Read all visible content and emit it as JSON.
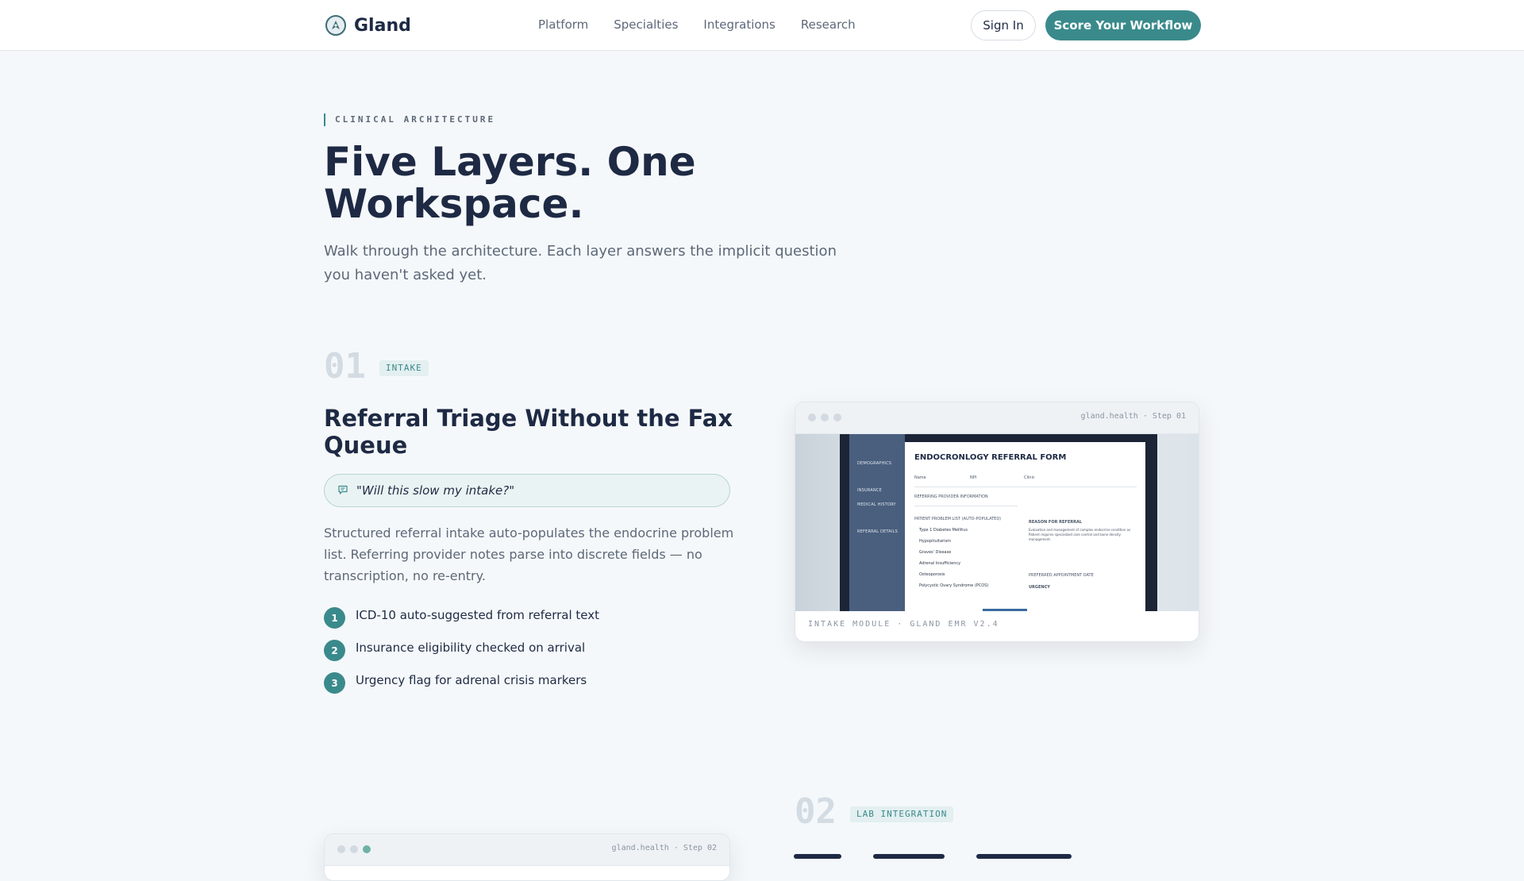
{
  "nav": {
    "brand": "Gland",
    "links": [
      "Platform",
      "Specialties",
      "Integrations",
      "Research"
    ],
    "sign_in": "Sign In",
    "cta": "Score Your Workflow"
  },
  "hero": {
    "eyebrow": "CLINICAL ARCHITECTURE",
    "title": "Five Layers. One Workspace.",
    "subtitle": "Walk through the architecture. Each layer answers the implicit question you haven't asked yet."
  },
  "step1": {
    "number": "01",
    "tag": "INTAKE",
    "title": "Referral Triage Without the Fax Queue",
    "quote": "\"Will this slow my intake?\"",
    "body": "Structured referral intake auto-populates the endocrine problem list. Referring provider notes parse into discrete fields — no transcription, no re-entry.",
    "features": [
      {
        "n": "1",
        "text": "ICD-10 auto-suggested from referral text"
      },
      {
        "n": "2",
        "text": "Insurance eligibility checked on arrival"
      },
      {
        "n": "3",
        "text": "Urgency flag for adrenal crisis markers"
      }
    ],
    "browser": {
      "url": "gland.health · Step 01",
      "caption": "INTAKE MODULE · GLAND EMR V2.4",
      "form": {
        "title": "ENDOCRONLOGY REFERRAL FORM",
        "sidebar": [
          "DEMOGRAPHICS",
          "INSURANCE",
          "MEDICAL HISTORY",
          "REFERRAL DETAILS"
        ],
        "fields": [
          "Name",
          "NPI",
          "Clinic"
        ],
        "section_provider": "REFERRING PROVIDER INFORMATION",
        "section_problems": "PATIENT PROBLEM LIST (AUTO-POPULATED)",
        "section_reason": "REASON FOR REFERRAL",
        "reason_text": "Evaluation and management of complex endocrine condition as Patient requires specialized care control and bone density management.",
        "section_date": "PREFERRED APPOINTMENT DATE",
        "section_urgency": "URGENCY",
        "problems": [
          "Type 1 Diabetes Mellitus",
          "Hypopituitarism",
          "Graves' Disease",
          "Adrenal Insufficiency",
          "Osteoporosis",
          "Polycystic Ovary Syndrome (PCOS)"
        ]
      }
    }
  },
  "step2": {
    "number": "02",
    "tag": "LAB INTEGRATION",
    "browser_url": "gland.health · Step 02"
  },
  "colors": {
    "accent": "#3a8a8c",
    "navy": "#1e2a44",
    "muted": "#5d6878",
    "background": "#f5f8fa"
  },
  "icons": {
    "logo": "gland-logo-icon",
    "quote": "speech-bubble-icon"
  }
}
